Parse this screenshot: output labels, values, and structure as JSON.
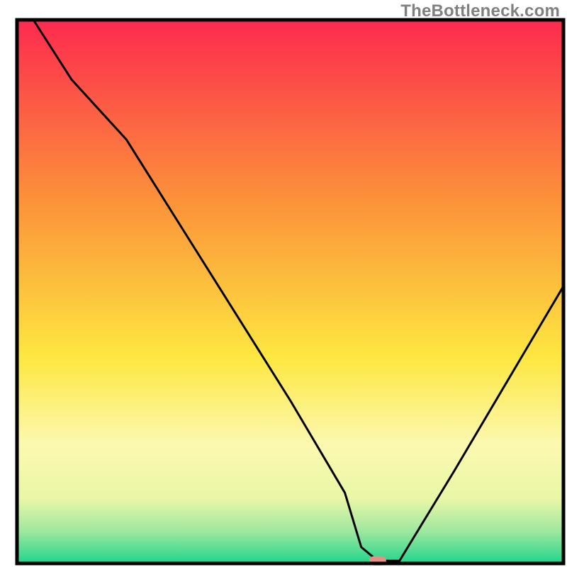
{
  "watermark": "TheBottleneck.com",
  "chart_data": {
    "type": "line",
    "title": "",
    "xlabel": "",
    "ylabel": "",
    "xlim": [
      0,
      100
    ],
    "ylim": [
      0,
      100
    ],
    "x": [
      3,
      10,
      20,
      30,
      40,
      50,
      60,
      63,
      66,
      70,
      80,
      90,
      100
    ],
    "values": [
      100,
      89,
      78,
      62,
      46,
      30,
      13,
      3,
      0.5,
      0.5,
      17,
      34,
      51
    ],
    "marker": {
      "x": 66,
      "y": 0.5,
      "color": "#e98d87"
    },
    "gradient_stops": [
      {
        "offset": 0.0,
        "color": "#fd2a4f"
      },
      {
        "offset": 0.33,
        "color": "#fc913a"
      },
      {
        "offset": 0.62,
        "color": "#fde740"
      },
      {
        "offset": 0.78,
        "color": "#fcf8b0"
      },
      {
        "offset": 0.88,
        "color": "#e9f7a6"
      },
      {
        "offset": 0.94,
        "color": "#9fe8a0"
      },
      {
        "offset": 1.0,
        "color": "#20d58a"
      }
    ],
    "frame_color": "#000000",
    "line_color": "#000000"
  }
}
